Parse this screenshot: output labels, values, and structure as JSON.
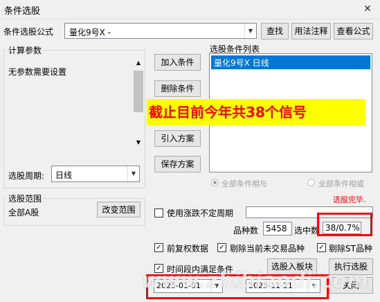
{
  "window": {
    "title": "条件选股",
    "close_glyph": "✕"
  },
  "formula": {
    "label": "条件选股公式",
    "value": "量化9号X  -",
    "find_button": "查找",
    "usage_button": "用法注释",
    "view_button": "查看公式"
  },
  "params": {
    "group_label": "计算参数",
    "no_params_text": "无参数需要设置",
    "period_label": "选股周期:",
    "period_value": "日线"
  },
  "actions": {
    "add": "加入条件",
    "delete": "删除条件",
    "import": "引入方案",
    "save": "保存方案"
  },
  "condition_list": {
    "label": "选股条件列表",
    "items": [
      "量化9号X  日线"
    ],
    "and_label": "全部条件相与",
    "or_label": "全部条件相或"
  },
  "annotation": {
    "text": "截止目前今年共38个信号",
    "color": "#ff0000",
    "highlight_color": "#ffff00"
  },
  "status": {
    "text": "选股完毕.",
    "color": "#ff0000"
  },
  "range": {
    "group_label": "选股范围",
    "value": "全部A股",
    "change_button": "改变范围"
  },
  "options": {
    "variable_period_label": "使用涨跌不定周期",
    "count_label": "品种数",
    "count_value": "5458",
    "selected_label": "选中数",
    "selected_value": "38/0.7%",
    "adjust_label": "前复权数据",
    "exclude_untraded_label": "剔除当前未交易品种",
    "exclude_st_label": "剔除ST品种",
    "time_range_label": "时间段内满足条件",
    "date_start": "2025-01-01",
    "date_sep": "-",
    "date_end": "2025-11-21"
  },
  "bottom": {
    "board_button": "选股入板块",
    "execute_button": "执行选股",
    "close_button": "关闭"
  },
  "watermark": {
    "text": "www.zhibiaodi.com"
  }
}
